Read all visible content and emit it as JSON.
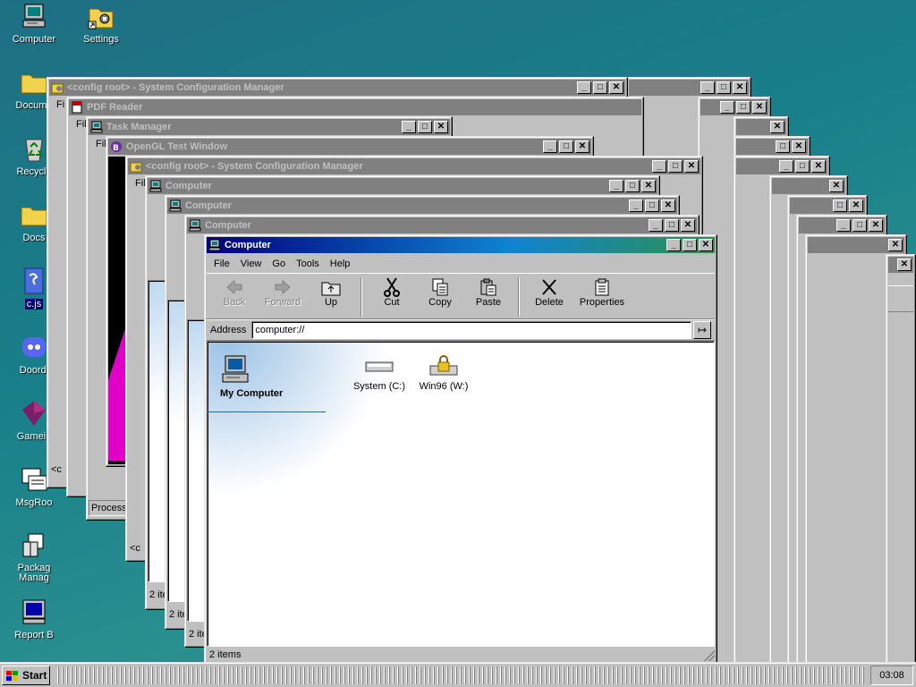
{
  "desktop": {
    "icons": [
      {
        "label": "Computer",
        "icon": "computer-icon"
      },
      {
        "label": "Settings",
        "icon": "settings-icon"
      },
      {
        "label": "Docume",
        "icon": "folder-icon"
      },
      {
        "label": "Recycle",
        "icon": "recycle-bin-icon"
      },
      {
        "label": "Docs",
        "icon": "folder-icon"
      },
      {
        "label": "c.js",
        "icon": "script-file-icon"
      },
      {
        "label": "Doordi",
        "icon": "discord-icon"
      },
      {
        "label": "Gamein",
        "icon": "game-icon"
      },
      {
        "label": "MsgRoo",
        "icon": "messages-icon"
      },
      {
        "label": "Packag Manag",
        "icon": "package-icon"
      },
      {
        "label": "Report B",
        "icon": "report-icon"
      }
    ]
  },
  "background_windows": [
    {
      "title": "<config root> - System Configuration Manager",
      "menu_fragment": "Fi",
      "footer": "<c"
    },
    {
      "title": "PDF Reader",
      "menu_fragment": "Fil"
    },
    {
      "title": "Task Manager",
      "menu_fragment": "File",
      "footer": "Process"
    },
    {
      "title": "OpenGL Test Window"
    },
    {
      "title": "<config root> - System Configuration Manager",
      "menu_fragment": "File",
      "footer": "<c"
    },
    {
      "title": "Computer",
      "footer": "2 ite"
    },
    {
      "title": "Computer",
      "footer": "2 ite"
    },
    {
      "title": "Computer",
      "footer": "2 ite"
    }
  ],
  "main_window": {
    "title": "Computer",
    "menu": [
      "File",
      "View",
      "Go",
      "Tools",
      "Help"
    ],
    "toolbar": [
      {
        "label": "Back",
        "enabled": false,
        "icon": "back-arrow-icon"
      },
      {
        "label": "Forward",
        "enabled": false,
        "icon": "forward-arrow-icon"
      },
      {
        "label": "Up",
        "enabled": true,
        "icon": "up-folder-icon"
      },
      {
        "label": "Cut",
        "enabled": true,
        "icon": "scissors-icon"
      },
      {
        "label": "Copy",
        "enabled": true,
        "icon": "copy-icon"
      },
      {
        "label": "Paste",
        "enabled": true,
        "icon": "paste-icon"
      },
      {
        "label": "Delete",
        "enabled": true,
        "icon": "delete-x-icon"
      },
      {
        "label": "Properties",
        "enabled": true,
        "icon": "properties-icon"
      }
    ],
    "address_label": "Address",
    "address_value": "computer://",
    "sidebar_title": "My Computer",
    "items": [
      {
        "label": "System (C:)",
        "icon": "hard-drive-icon"
      },
      {
        "label": "Win96 (W:)",
        "icon": "locked-drive-icon"
      }
    ],
    "status": "2 items"
  },
  "taskbar": {
    "start_label": "Start",
    "clock": "03:08"
  },
  "colors": {
    "desktop": "#1e7a86",
    "title_active_start": "#000080",
    "title_inactive": "#808080",
    "face": "#c0c0c0"
  }
}
